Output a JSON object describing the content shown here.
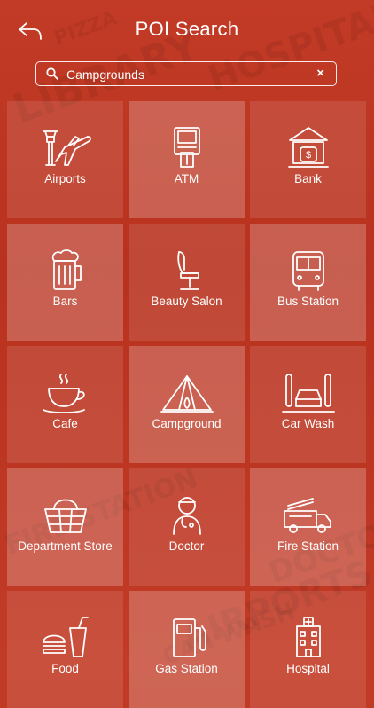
{
  "header": {
    "title": "POI Search"
  },
  "search": {
    "value": "Campgrounds",
    "clear_label": "×"
  },
  "background_words": [
    "HOSPITAL",
    "LIBRARY",
    "AIRPORTS",
    "PIZZA",
    "CAR WASH",
    "FIRE STATION",
    "DOCTOR"
  ],
  "items": [
    {
      "label": "Airports",
      "icon": "airport-icon"
    },
    {
      "label": "ATM",
      "icon": "atm-icon"
    },
    {
      "label": "Bank",
      "icon": "bank-icon"
    },
    {
      "label": "Bars",
      "icon": "beer-mug-icon"
    },
    {
      "label": "Beauty Salon",
      "icon": "salon-chair-icon"
    },
    {
      "label": "Bus Station",
      "icon": "bus-icon"
    },
    {
      "label": "Cafe",
      "icon": "coffee-cup-icon"
    },
    {
      "label": "Campground",
      "icon": "tent-icon"
    },
    {
      "label": "Car Wash",
      "icon": "car-wash-icon"
    },
    {
      "label": "Department Store",
      "icon": "shopping-basket-icon"
    },
    {
      "label": "Doctor",
      "icon": "doctor-icon"
    },
    {
      "label": "Fire Station",
      "icon": "fire-truck-icon"
    },
    {
      "label": "Food",
      "icon": "fast-food-icon"
    },
    {
      "label": "Gas Station",
      "icon": "gas-pump-icon"
    },
    {
      "label": "Hospital",
      "icon": "hospital-icon"
    }
  ],
  "colors": {
    "background": "#c23b26",
    "tile": "rgba(255,255,255,0.11)",
    "tile_alt": "rgba(255,255,255,0.22)",
    "text": "#ffffff"
  }
}
